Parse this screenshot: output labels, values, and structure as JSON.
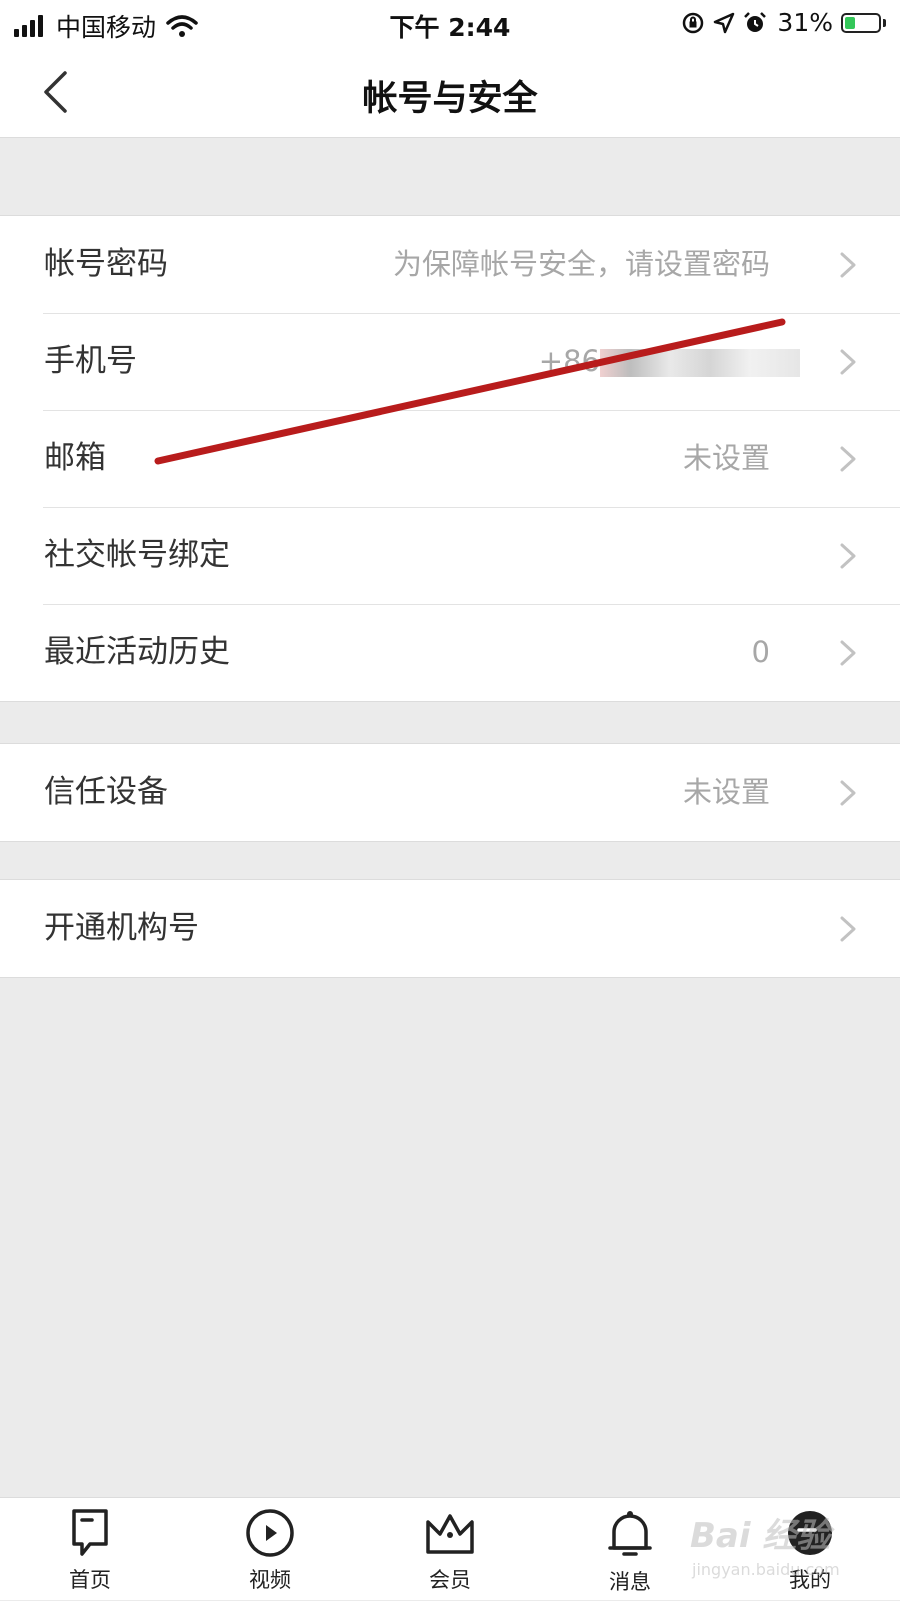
{
  "status_bar": {
    "carrier": "中国移动",
    "time": "下午 2:44",
    "battery_percent": "31%",
    "battery_level": 0.31,
    "battery_color": "#34c759"
  },
  "nav": {
    "title": "帐号与安全",
    "back_icon": "chevron-left-icon"
  },
  "groups": [
    {
      "rows": [
        {
          "label": "帐号密码",
          "value": "为保障帐号安全，请设置密码"
        },
        {
          "label": "手机号",
          "value": "+86"
        },
        {
          "label": "邮箱",
          "value": "未设置"
        },
        {
          "label": "社交帐号绑定",
          "value": ""
        },
        {
          "label": "最近活动历史",
          "value": "0"
        }
      ]
    },
    {
      "rows": [
        {
          "label": "信任设备",
          "value": "未设置"
        }
      ]
    },
    {
      "rows": [
        {
          "label": "开通机构号",
          "value": ""
        }
      ]
    }
  ],
  "tab_bar": {
    "tabs": [
      {
        "label": "首页",
        "icon": "bookmark-home-icon"
      },
      {
        "label": "视频",
        "icon": "play-circle-icon"
      },
      {
        "label": "会员",
        "icon": "crown-icon"
      },
      {
        "label": "消息",
        "icon": "bell-icon"
      },
      {
        "label": "我的",
        "icon": "profile-icon"
      }
    ]
  },
  "annotation_color": "#b81c1c",
  "watermark": {
    "line1": "Bai 经验",
    "line2": "jingyan.baidu.com"
  }
}
